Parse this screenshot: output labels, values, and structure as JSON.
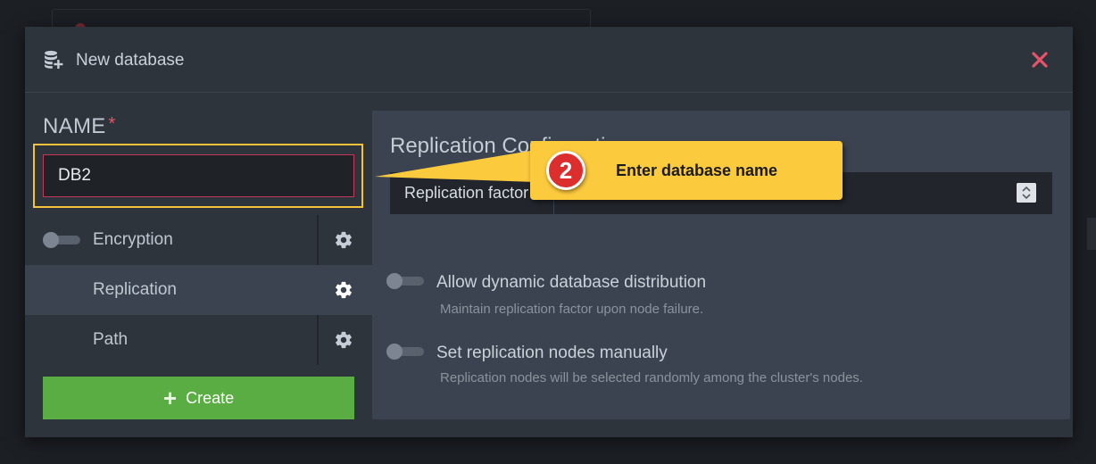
{
  "modal": {
    "title": "New database",
    "icon": "database-add-icon",
    "close_icon": "close-icon"
  },
  "name_field": {
    "label": "NAME",
    "required_mark": "*",
    "value": "DB2"
  },
  "sidebar": {
    "items": [
      {
        "label": "Encryption",
        "has_toggle": true,
        "active": false,
        "icon": "gear-icon"
      },
      {
        "label": "Replication",
        "has_toggle": false,
        "active": true,
        "icon": "gear-icon"
      },
      {
        "label": "Path",
        "has_toggle": false,
        "active": false,
        "icon": "gear-icon"
      }
    ]
  },
  "create_button": {
    "label": "Create",
    "icon": "plus-icon"
  },
  "replication_panel": {
    "title": "Replication Configuration",
    "factor_label": "Replication factor",
    "options": [
      {
        "label": "Allow dynamic database distribution",
        "description": "Maintain replication factor upon node failure."
      },
      {
        "label": "Set replication nodes manually",
        "description": "Replication nodes will be selected randomly among the cluster's nodes."
      }
    ]
  },
  "callout": {
    "number": "2",
    "text": "Enter database name"
  },
  "colors": {
    "accent_green": "#5aad42",
    "close_red": "#e5546a",
    "highlight_yellow": "#f5c33b",
    "callout_yellow": "#fcca3d",
    "callout_badge_red": "#dd2e2e"
  }
}
